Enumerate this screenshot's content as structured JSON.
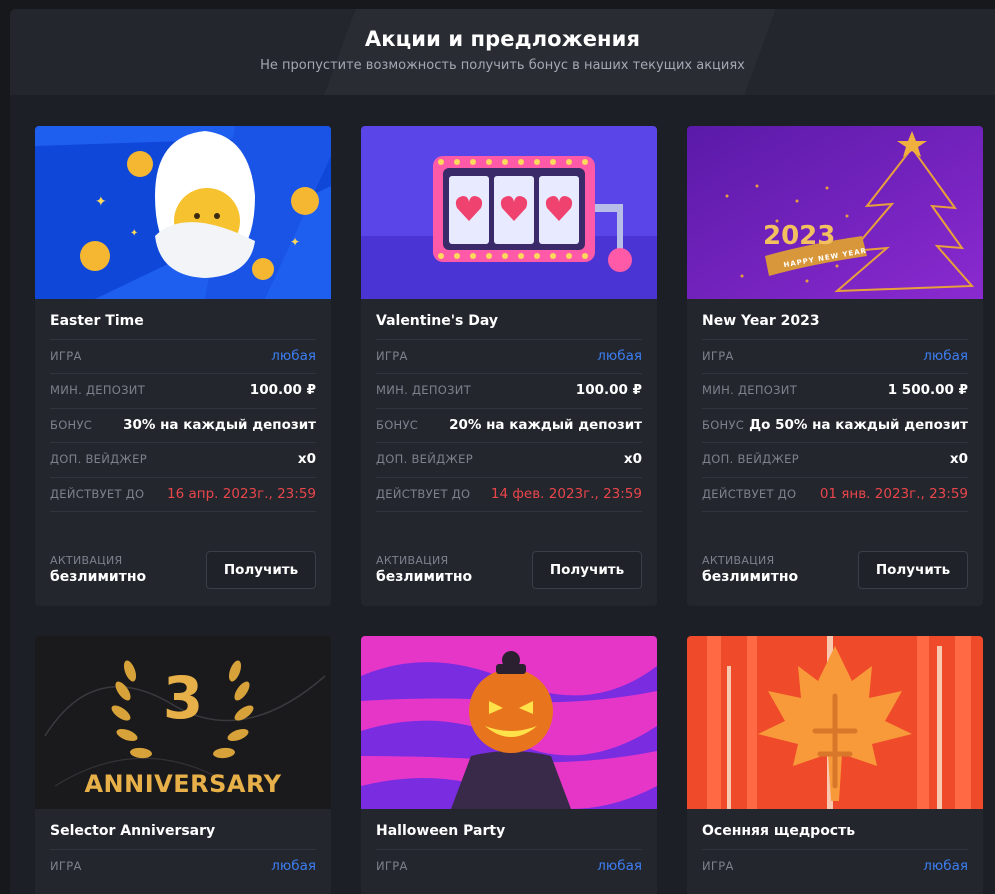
{
  "header": {
    "title": "Акции и предложения",
    "subtitle": "Не пропустите возможность получить бонус в наших текущих акциях"
  },
  "labels": {
    "game": "ИГРА",
    "min_deposit": "МИН. ДЕПОЗИТ",
    "bonus": "БОНУС",
    "wager": "ДОП. ВЕЙДЖЕР",
    "valid_until": "ДЕЙСТВУЕТ ДО",
    "activation": "АКТИВАЦИЯ",
    "get_button": "Получить"
  },
  "colors": {
    "background": "#16181c",
    "card": "#23262d",
    "accent_blue": "#3d7ef2",
    "accent_red": "#e8464b"
  },
  "promotions": [
    {
      "title": "Easter Time",
      "game": "любая",
      "min_deposit": "100.00 ₽",
      "bonus": "30% на каждый депозит",
      "wager": "x0",
      "valid_until": "16 апр. 2023г., 23:59",
      "activation": "безлимитно",
      "image_icon": "easter-egg-coin-image"
    },
    {
      "title": "Valentine's Day",
      "game": "любая",
      "min_deposit": "100.00 ₽",
      "bonus": "20% на каждый депозит",
      "wager": "x0",
      "valid_until": "14 фев. 2023г., 23:59",
      "activation": "безлимитно",
      "image_icon": "slot-machine-hearts-image"
    },
    {
      "title": "New Year 2023",
      "game": "любая",
      "min_deposit": "1 500.00 ₽",
      "bonus": "До 50% на каждый депозит",
      "wager": "x0",
      "valid_until": "01 янв. 2023г., 23:59",
      "activation": "безлимитно",
      "image_icon": "new-year-tree-image",
      "image_text": {
        "year": "2023",
        "ribbon": "HAPPY NEW YEAR"
      }
    },
    {
      "title": "Selector Anniversary",
      "game": "любая",
      "image_icon": "anniversary-laurel-image",
      "image_text": {
        "number": "3",
        "word": "ANNIVERSARY"
      }
    },
    {
      "title": "Halloween Party",
      "game": "любая",
      "image_icon": "pumpkin-character-image"
    },
    {
      "title": "Осенняя щедрость",
      "game": "любая",
      "image_icon": "maple-leaf-image"
    }
  ]
}
